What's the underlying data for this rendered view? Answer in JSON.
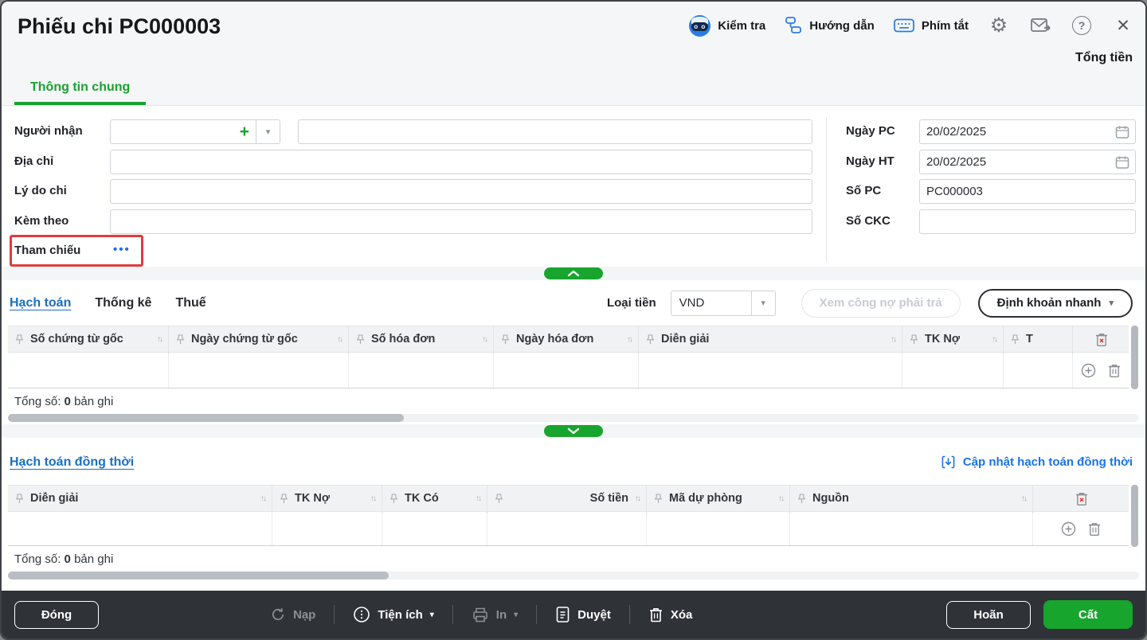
{
  "window": {
    "title": "Phiếu chi PC000003",
    "total_label": "Tổng tiền"
  },
  "toolbar": {
    "check_label": "Kiểm tra",
    "guide_label": "Hướng dẫn",
    "shortcut_label": "Phím tắt"
  },
  "tabs": {
    "general": "Thông tin chung"
  },
  "form": {
    "receiver_label": "Người nhận",
    "address_label": "Địa chỉ",
    "reason_label": "Lý do chi",
    "attachment_label": "Kèm theo",
    "reference_label": "Tham chiếu",
    "reference_more_glyph": "•••",
    "right": {
      "date_pc_label": "Ngày PC",
      "date_pc_value": "20/02/2025",
      "date_ht_label": "Ngày HT",
      "date_ht_value": "20/02/2025",
      "no_pc_label": "Số PC",
      "no_pc_value": "PC000003",
      "no_ckc_label": "Số CKC",
      "no_ckc_value": ""
    }
  },
  "accounting": {
    "tabs": [
      "Hạch toán",
      "Thống kê",
      "Thuế"
    ],
    "currency_label": "Loại tiền",
    "currency_value": "VND",
    "view_debt_button": "Xem công nợ phải trả",
    "quick_entry_button": "Định khoản nhanh",
    "table": {
      "columns": [
        "Số chứng từ gốc",
        "Ngày chứng từ gốc",
        "Số hóa đơn",
        "Ngày hóa đơn",
        "Diễn giải",
        "TK Nợ",
        "T"
      ],
      "total_prefix": "Tổng số:",
      "total_count": "0",
      "total_suffix": "bản ghi"
    }
  },
  "simultaneous": {
    "title": "Hạch toán đồng thời",
    "update_link": "Cập nhật hạch toán đồng thời",
    "table": {
      "columns": [
        "Diễn giải",
        "TK Nợ",
        "TK Có",
        "Số tiền",
        "Mã dự phòng",
        "Nguồn"
      ],
      "total_prefix": "Tổng số:",
      "total_count": "0",
      "total_suffix": "bản ghi"
    }
  },
  "footer": {
    "close": "Đóng",
    "reload": "Nạp",
    "utilities": "Tiện ích",
    "print": "In",
    "approve": "Duyệt",
    "delete": "Xóa",
    "postpone": "Hoãn",
    "save": "Cất"
  },
  "glyphs": {
    "sort": "↑↓",
    "caret_down": "▾",
    "gear": "⚙",
    "help": "?",
    "close": "✕",
    "plus": "+",
    "dots_v": "⋮"
  },
  "colors": {
    "accent_green": "#18a52d",
    "link_blue": "#1a73e8",
    "tab_blue": "#1b6fc2",
    "highlight_red": "#e03c3c",
    "footer_dark": "#2f3237",
    "icon_blue": "#2a7de1"
  }
}
